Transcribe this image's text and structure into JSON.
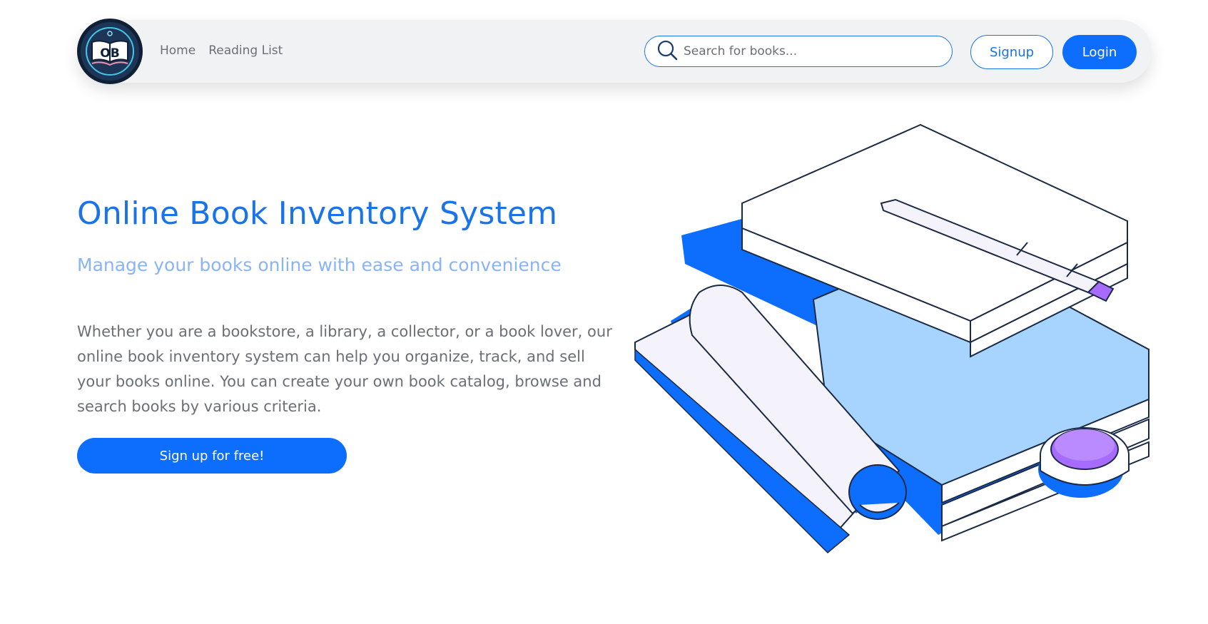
{
  "nav": {
    "logo_text": "OB",
    "links": [
      "Home",
      "Reading List"
    ],
    "search_placeholder": "Search for books...",
    "signup_label": "Signup",
    "login_label": "Login"
  },
  "hero": {
    "title": "Online Book Inventory System",
    "subtitle": "Manage your books online with ease and convenience",
    "description": "Whether you are a bookstore, a library, a collector, or a book lover, our online book inventory system can help you organize, track, and sell your books online. You can create your own book catalog, browse and search books by various criteria.",
    "cta_label": "Sign up for free!"
  },
  "colors": {
    "primary": "#0d6efd",
    "title_blue": "#1a73e8",
    "subtitle_blue": "#8ab4f8",
    "light_blue": "#a7d3ff",
    "accent_purple": "#a86bff"
  }
}
